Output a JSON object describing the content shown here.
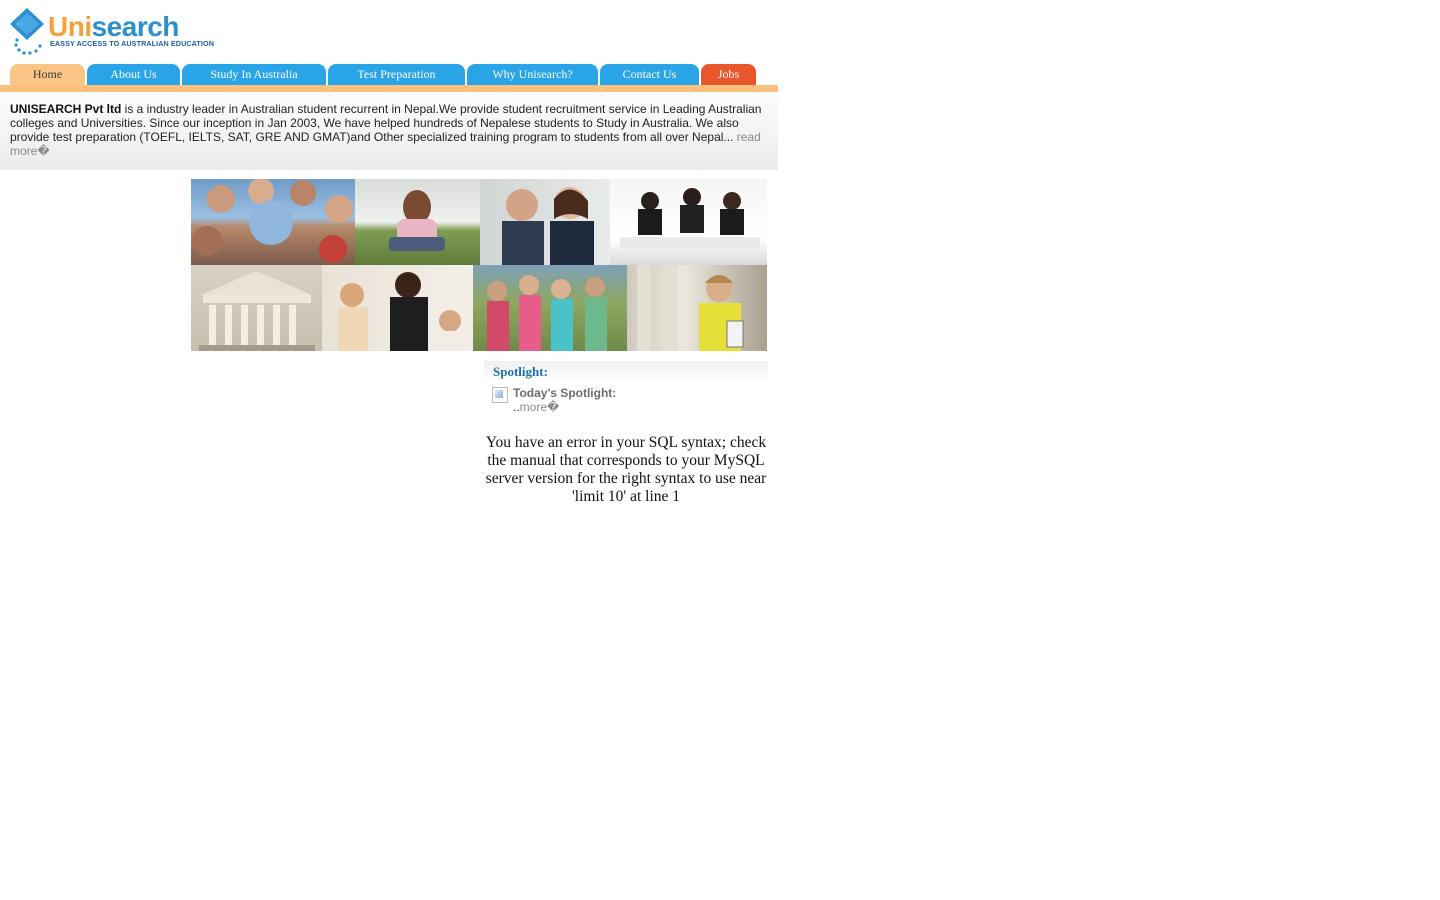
{
  "logo": {
    "word_part1": "Uni",
    "word_part2": "search",
    "tagline": "EASSY ACCESS TO AUSTRALIAN EDUCATION"
  },
  "nav": [
    {
      "label": "Home",
      "style": "home"
    },
    {
      "label": "About Us",
      "style": "blue"
    },
    {
      "label": "Study In Australia",
      "style": "blue"
    },
    {
      "label": "Test Preparation",
      "style": "blue"
    },
    {
      "label": "Why Unisearch?",
      "style": "blue"
    },
    {
      "label": "Contact Us",
      "style": "blue"
    },
    {
      "label": "Jobs",
      "style": "jobs"
    }
  ],
  "intro": {
    "company": "UNISEARCH Pvt ltd",
    "text": " is a industry leader in Australian student recurrent in Nepal.We provide student recruitment service in Leading Australian colleges and Universities. Since our inception in Jan 2003, We have helped hundreds of Nepalese students to Study in Australia. We also provide test preparation (TOEFL, IELTS, SAT, GRE AND GMAT)and Other specialized training program to students from all over Nepal... ",
    "read_more": "read more�"
  },
  "collage": {
    "photos": [
      "students-circle-photo",
      "girl-reading-photo",
      "business-couple-photo",
      "meeting-photo",
      "university-building-photo",
      "teacher-students-photo",
      "group-of-girls-photo",
      "student-with-books-photo"
    ]
  },
  "spotlight": {
    "title": "Spotlight:",
    "label": "Today's Spotlight:",
    "prefix": "..",
    "more": "more�"
  },
  "error_message": "You have an error in your SQL syntax; check the manual that corresponds to your MySQL server version for the right syntax to use near 'limit 10' at line 1",
  "colors": {
    "nav_home": "#fbc685",
    "nav_blue": "#29a4e6",
    "nav_jobs": "#e8562b",
    "nav_bar": "#fbc07b",
    "spotlight_title": "#1d6fb0"
  }
}
